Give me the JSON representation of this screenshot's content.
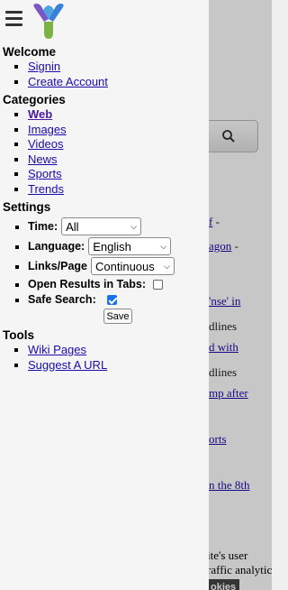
{
  "drawer": {
    "sections": {
      "welcome": "Welcome",
      "categories": "Categories",
      "settings": "Settings",
      "tools": "Tools"
    },
    "welcome_links": [
      "Signin",
      "Create Account"
    ],
    "category_links": [
      "Web",
      "Images",
      "Videos",
      "News",
      "Sports",
      "Trends"
    ],
    "active_category": "Web",
    "settings": {
      "time_label": "Time:",
      "time_value": "All",
      "language_label": "Language:",
      "language_value": "English",
      "links_label": "Links/Page",
      "links_value": "Continuous",
      "open_tabs_label": "Open Results in Tabs:",
      "open_tabs_checked": false,
      "safe_search_label": "Safe Search:",
      "safe_search_checked": true,
      "save_label": "Save"
    },
    "tool_links": [
      "Wiki Pages",
      "Suggest A URL"
    ]
  },
  "background": {
    "lines": [
      {
        "text": "f",
        "suffix": " -"
      },
      {
        "text": "agon",
        "suffix": " -"
      },
      {
        "text": "'nse' in",
        "suffix": ""
      },
      {
        "text": "dlines",
        "suffix": ""
      },
      {
        "text": "d with",
        "suffix": ""
      },
      {
        "text": "dlines",
        "suffix": ""
      },
      {
        "text": "mp after",
        "suffix": ""
      },
      {
        "text": "orts",
        "suffix": ""
      },
      {
        "text": "n the 8th",
        "suffix": ""
      }
    ],
    "cookie_text_1": "ite's user",
    "cookie_text_2": "raffic analytic",
    "cookie_button": "okies"
  },
  "icons": {
    "menu": "hamburger-icon",
    "logo": "site-logo",
    "search": "search-icon"
  },
  "colors": {
    "link": "#1a0dab",
    "active_link": "#4a1a9c",
    "drawer_bg": "#f5f5f5",
    "checkbox_accent": "#1a73e8"
  }
}
